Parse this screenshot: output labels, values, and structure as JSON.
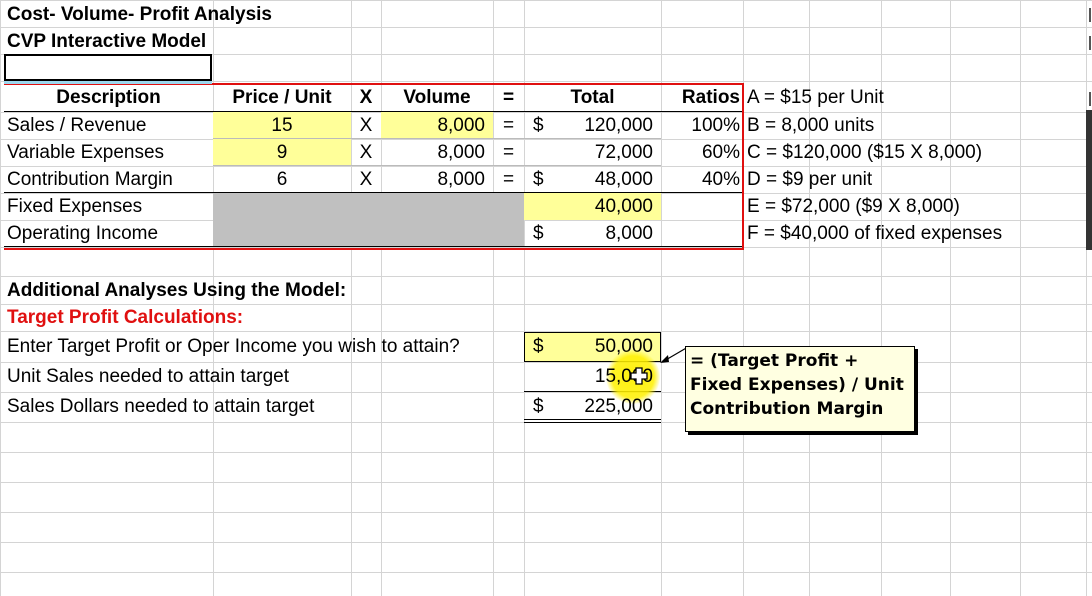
{
  "header": {
    "title1": "Cost- Volume- Profit Analysis",
    "title2": "CVP Interactive Model"
  },
  "table": {
    "headers": {
      "description": "Description",
      "price_unit": "Price / Unit",
      "x": "X",
      "volume": "Volume",
      "eq": "=",
      "total": "Total",
      "ratios": "Ratios"
    },
    "rows": {
      "sales": {
        "label": "Sales / Revenue",
        "price": "15",
        "x": "X",
        "volume": "8,000",
        "eq": "=",
        "dollar": "$",
        "total": "120,000",
        "ratio": "100%"
      },
      "variable": {
        "label": "Variable Expenses",
        "price": "9",
        "x": "X",
        "volume": "8,000",
        "eq": "=",
        "dollar": "",
        "total": "72,000",
        "ratio": "60%"
      },
      "contribution": {
        "label": "Contribution Margin",
        "price": "6",
        "x": "X",
        "volume": "8,000",
        "eq": "=",
        "dollar": "$",
        "total": "48,000",
        "ratio": "40%"
      },
      "fixed": {
        "label": "Fixed Expenses",
        "total": "40,000"
      },
      "operating": {
        "label": "Operating Income",
        "dollar": "$",
        "total": "8,000"
      }
    }
  },
  "notes": [
    "A = $15 per Unit",
    "B = 8,000 units",
    "C =  $120,000  ($15 X 8,000)",
    "D = $9 per unit",
    "E = $72,000 ($9 X 8,000)",
    "F = $40,000 of fixed expenses"
  ],
  "analysis": {
    "heading": "Additional Analyses Using the Model:",
    "subheading": "Target Profit Calculations:",
    "rows": [
      {
        "label": "Enter Target Profit or Oper Income you wish to attain?",
        "dollar": "$",
        "value": "50,000"
      },
      {
        "label": "Unit Sales needed to attain target",
        "dollar": "",
        "value": "15,000"
      },
      {
        "label": "Sales Dollars needed to attain target",
        "dollar": "$",
        "value": "225,000"
      }
    ]
  },
  "comment": {
    "line1": "= (Target Profit +",
    "line2": "Fixed Expenses) / Unit",
    "line3": "Contribution Margin"
  },
  "colors": {
    "input_yellow": "#ffff99",
    "gray_block": "#c0c0c0",
    "table_border_red": "#e01010",
    "comment_bg": "#ffffe1"
  }
}
